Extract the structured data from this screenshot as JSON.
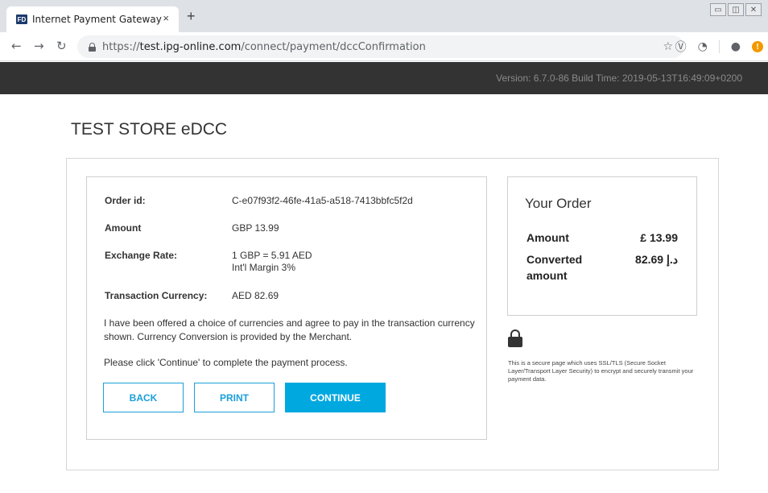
{
  "browser": {
    "tab_title": "Internet Payment Gateway",
    "favicon_text": "FD",
    "tab_close": "×",
    "new_tab": "+",
    "url_scheme": "https://",
    "url_host": "test.ipg-online.com",
    "url_path": "/connect/payment/dccConfirmation",
    "icons": [
      "back-arrow-icon",
      "forward-arrow-icon",
      "reload-icon",
      "lock-icon",
      "star-icon",
      "vivaldi-icon",
      "circle-icon",
      "account-icon",
      "warning-icon"
    ]
  },
  "header": {
    "version": "Version: 6.7.0-86 Build Time: 2019-05-13T16:49:09+0200"
  },
  "page": {
    "title": "TEST STORE eDCC"
  },
  "details": {
    "order_id_label": "Order id:",
    "order_id_value": "C-e07f93f2-46fe-41a5-a518-7413bbfc5f2d",
    "amount_label": "Amount",
    "amount_value": "GBP 13.99",
    "exchange_label": "Exchange Rate:",
    "exchange_value": "1 GBP = 5.91 AED",
    "margin_value": "Int'l Margin 3%",
    "currency_label": "Transaction Currency:",
    "currency_value": "AED 82.69",
    "paragraph1": "I have been offered a choice of currencies and agree to pay in the transaction currency shown. Currency Conversion is provided by the Merchant.",
    "paragraph2": "Please click 'Continue' to complete the payment process."
  },
  "buttons": {
    "back": "BACK",
    "print": "PRINT",
    "continue": "CONTINUE"
  },
  "order": {
    "title": "Your Order",
    "amount_label": "Amount",
    "amount_value": "£ 13.99",
    "converted_label_line1": "Converted",
    "converted_label_line2": "amount",
    "converted_value": "82.69 د.إ"
  },
  "secure_note": "This is a secure page which uses SSL/TLS (Secure Socket Layer/Transport Layer Security) to encrypt and securely transmit your payment data.",
  "colors": {
    "accent": "#00a8e0",
    "header_bg": "#333333"
  }
}
